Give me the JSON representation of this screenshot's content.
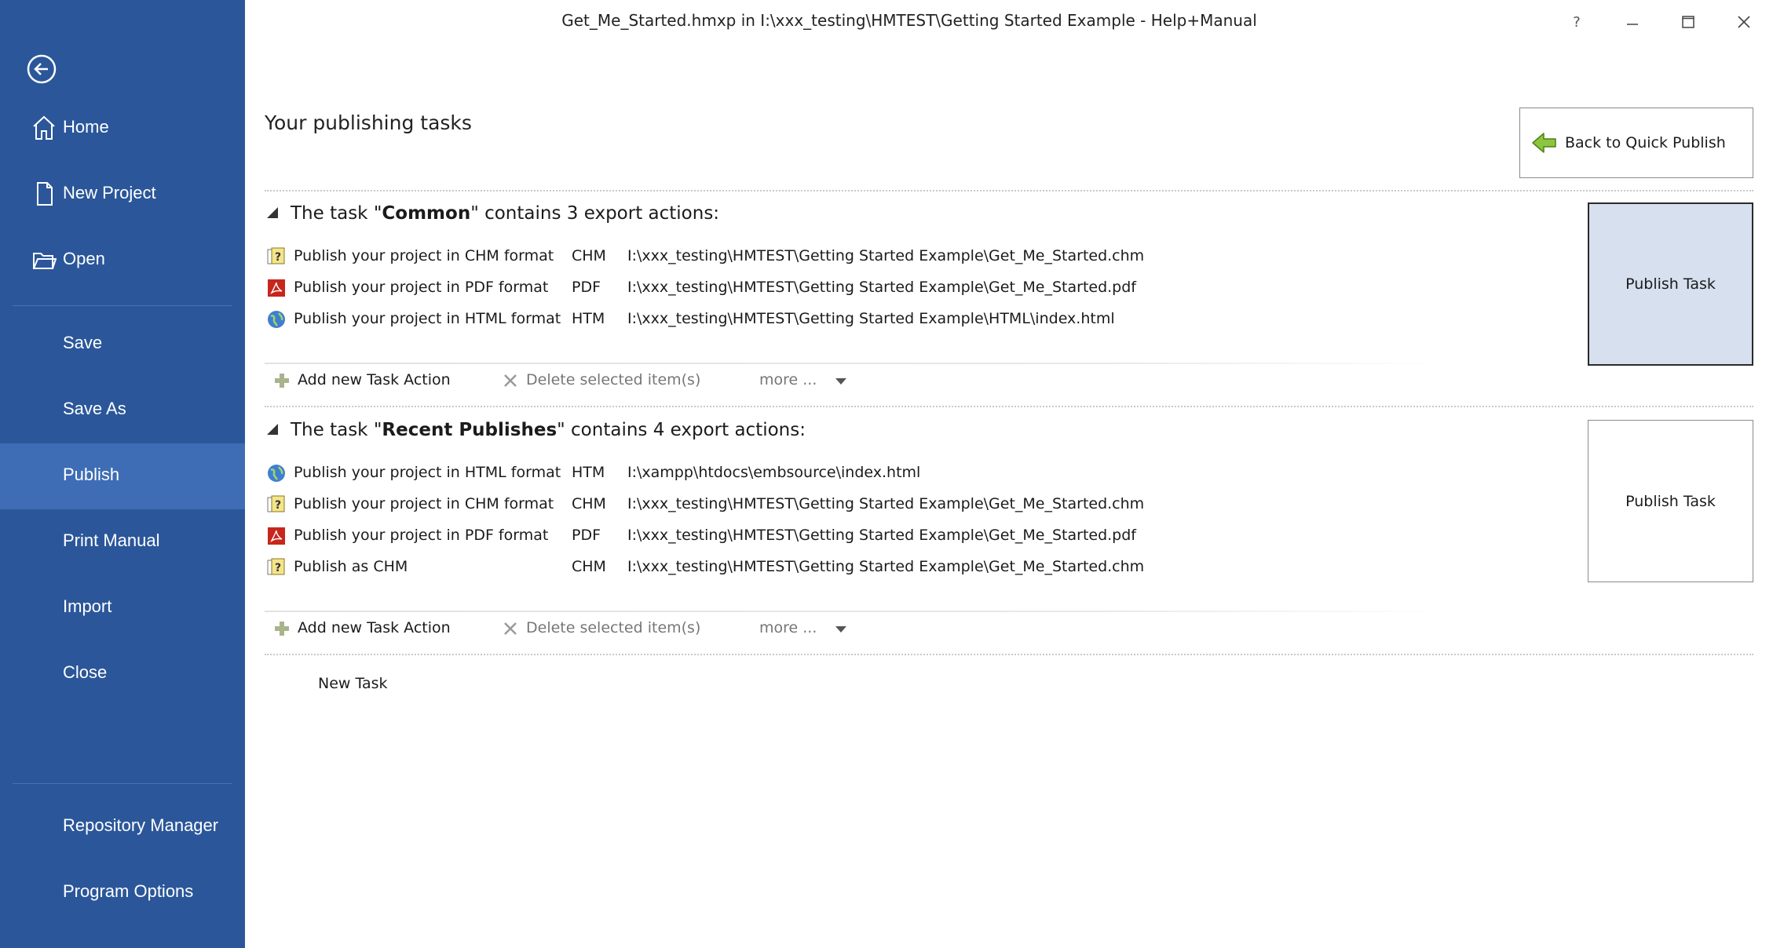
{
  "window": {
    "title": "Get_Me_Started.hmxp in I:\\xxx_testing\\HMTEST\\Getting Started Example - Help+Manual",
    "help_label": "?"
  },
  "sidebar": {
    "back_icon": "back-arrow-circle-icon",
    "items": [
      {
        "label": "Home",
        "icon": "home-icon"
      },
      {
        "label": "New Project",
        "icon": "document-icon"
      },
      {
        "label": "Open",
        "icon": "folder-icon"
      },
      {
        "label": "Save"
      },
      {
        "label": "Save As"
      },
      {
        "label": "Publish",
        "active": true
      },
      {
        "label": "Print Manual"
      },
      {
        "label": "Import"
      },
      {
        "label": "Close"
      },
      {
        "label": "Repository Manager"
      },
      {
        "label": "Program Options"
      }
    ]
  },
  "main": {
    "title": "Your publishing tasks",
    "back_to_quick_publish": "Back to Quick Publish",
    "tasks": [
      {
        "prefix": "The task \"",
        "name": "Common",
        "suffix": "\" contains 3 export actions:",
        "publish_label": "Publish Task",
        "actions": [
          {
            "name": "Publish your project in CHM format",
            "format": "CHM",
            "path": "I:\\xxx_testing\\HMTEST\\Getting Started Example\\Get_Me_Started.chm",
            "icon": "chm-help-icon"
          },
          {
            "name": "Publish your project in PDF format",
            "format": "PDF",
            "path": "I:\\xxx_testing\\HMTEST\\Getting Started Example\\Get_Me_Started.pdf",
            "icon": "pdf-icon"
          },
          {
            "name": "Publish your project in HTML format",
            "format": "HTM",
            "path": "I:\\xxx_testing\\HMTEST\\Getting Started Example\\HTML\\index.html",
            "icon": "globe-icon"
          }
        ]
      },
      {
        "prefix": "The task \"",
        "name": "Recent Publishes",
        "suffix": "\" contains 4 export actions:",
        "publish_label": "Publish Task",
        "actions": [
          {
            "name": "Publish your project in HTML format",
            "format": "HTM",
            "path": "I:\\xampp\\htdocs\\embsource\\index.html",
            "icon": "globe-icon"
          },
          {
            "name": "Publish your project in CHM format",
            "format": "CHM",
            "path": "I:\\xxx_testing\\HMTEST\\Getting Started Example\\Get_Me_Started.chm",
            "icon": "chm-help-icon"
          },
          {
            "name": "Publish your project in PDF format",
            "format": "PDF",
            "path": "I:\\xxx_testing\\HMTEST\\Getting Started Example\\Get_Me_Started.pdf",
            "icon": "pdf-icon"
          },
          {
            "name": "Publish as CHM",
            "format": "CHM",
            "path": "I:\\xxx_testing\\HMTEST\\Getting Started Example\\Get_Me_Started.chm",
            "icon": "chm-help-icon"
          }
        ]
      }
    ],
    "toolbar": {
      "add_label": "Add new Task Action",
      "delete_label": "Delete selected item(s)",
      "more_label": "more ..."
    },
    "new_task_label": "New Task"
  },
  "colors": {
    "sidebar_bg": "#2b579a",
    "sidebar_active": "#3e6db5",
    "selected_task_bg": "#d6e0ef"
  }
}
